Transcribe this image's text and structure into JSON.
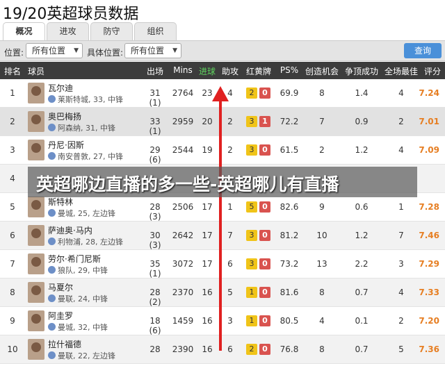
{
  "page_title": "19/20英超球员数据",
  "tabs": [
    {
      "label": "概况",
      "active": true
    },
    {
      "label": "进攻",
      "active": false
    },
    {
      "label": "防守",
      "active": false
    },
    {
      "label": "组织",
      "active": false
    }
  ],
  "filters": {
    "position_label": "位置:",
    "position_value": "所有位置",
    "specific_label": "具体位置:",
    "specific_value": "所有位置",
    "query_button": "查询"
  },
  "columns": [
    "排名",
    "球员",
    "出场",
    "Mins",
    "进球",
    "助攻",
    "红黄牌",
    "PS%",
    "创造机会",
    "争顶成功",
    "全场最佳",
    "评分"
  ],
  "highlight_column": "进球",
  "colors": {
    "header_bg": "#3c3c3c",
    "highlight": "#5fd35f",
    "rating": "#e67e22",
    "yellow_card": "#f0c419",
    "red_card": "#d9534f",
    "arrow": "#e02020"
  },
  "rows": [
    {
      "rank": "1",
      "name": "瓦尔迪",
      "info": "莱斯特城, 33, 中锋",
      "apps": "31 (1)",
      "mins": "2764",
      "goals": "23",
      "assists": "4",
      "yellow": "2",
      "red": "0",
      "ps": "69.9",
      "chances": "8",
      "aerials": "1.4",
      "motm": "4",
      "rating": "7.24"
    },
    {
      "rank": "2",
      "name": "奥巴梅扬",
      "info": "阿森纳, 31, 中锋",
      "apps": "33 (1)",
      "mins": "2959",
      "goals": "20",
      "assists": "2",
      "yellow": "3",
      "red": "1",
      "ps": "72.2",
      "chances": "7",
      "aerials": "0.9",
      "motm": "2",
      "rating": "7.01"
    },
    {
      "rank": "3",
      "name": "丹尼·因斯",
      "info": "南安普敦, 27, 中锋",
      "apps": "29 (6)",
      "mins": "2544",
      "goals": "19",
      "assists": "2",
      "yellow": "3",
      "red": "0",
      "ps": "61.5",
      "chances": "2",
      "aerials": "1.2",
      "motm": "4",
      "rating": "7.09"
    },
    {
      "rank": "4",
      "name": "",
      "info": "",
      "apps": "",
      "mins": "",
      "goals": "",
      "assists": "",
      "yellow": "",
      "red": "",
      "ps": "",
      "chances": "",
      "aerials": "",
      "motm": "",
      "rating": "",
      "hidden": true
    },
    {
      "rank": "5",
      "name": "斯特林",
      "info": "曼城, 25, 左边锋",
      "apps": "28 (3)",
      "mins": "2506",
      "goals": "17",
      "assists": "1",
      "yellow": "5",
      "red": "0",
      "ps": "82.6",
      "chances": "9",
      "aerials": "0.6",
      "motm": "1",
      "rating": "7.28"
    },
    {
      "rank": "6",
      "name": "萨迪奥·马内",
      "info": "利物浦, 28, 左边锋",
      "apps": "30 (3)",
      "mins": "2642",
      "goals": "17",
      "assists": "7",
      "yellow": "3",
      "red": "0",
      "ps": "81.2",
      "chances": "10",
      "aerials": "1.2",
      "motm": "7",
      "rating": "7.46"
    },
    {
      "rank": "7",
      "name": "劳尔·希门尼斯",
      "info": "狼队, 29, 中锋",
      "apps": "35 (1)",
      "mins": "3072",
      "goals": "17",
      "assists": "6",
      "yellow": "3",
      "red": "0",
      "ps": "73.2",
      "chances": "13",
      "aerials": "2.2",
      "motm": "3",
      "rating": "7.29"
    },
    {
      "rank": "8",
      "name": "马夏尔",
      "info": "曼联, 24, 中锋",
      "apps": "28 (2)",
      "mins": "2370",
      "goals": "16",
      "assists": "5",
      "yellow": "1",
      "red": "0",
      "ps": "81.6",
      "chances": "8",
      "aerials": "0.7",
      "motm": "4",
      "rating": "7.33"
    },
    {
      "rank": "9",
      "name": "阿圭罗",
      "info": "曼城, 32, 中锋",
      "apps": "18 (6)",
      "mins": "1459",
      "goals": "16",
      "assists": "3",
      "yellow": "1",
      "red": "0",
      "ps": "80.5",
      "chances": "4",
      "aerials": "0.1",
      "motm": "2",
      "rating": "7.20"
    },
    {
      "rank": "10",
      "name": "拉什福德",
      "info": "曼联, 22, 左边锋",
      "apps": "28",
      "mins": "2390",
      "goals": "16",
      "assists": "6",
      "yellow": "2",
      "red": "0",
      "ps": "76.8",
      "chances": "8",
      "aerials": "0.7",
      "motm": "5",
      "rating": "7.36"
    }
  ],
  "overlay_text": "英超哪边直播的多一些-英超哪儿有直播"
}
